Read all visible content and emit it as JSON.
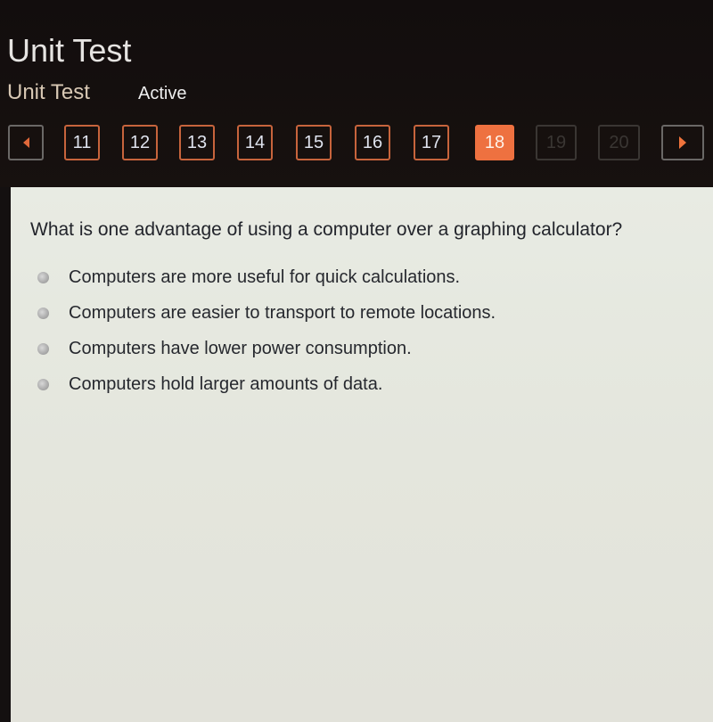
{
  "header": {
    "title": "Unit Test",
    "subtitle": "Unit Test",
    "status": "Active"
  },
  "pager": {
    "prev_icon": "triangle-left-icon",
    "next_icon": "triangle-right-icon",
    "pages": [
      "11",
      "12",
      "13",
      "14",
      "15",
      "16",
      "17",
      "18",
      "19",
      "20"
    ],
    "current": "18",
    "disabled": [
      "19",
      "20"
    ],
    "accent_color": "#ee7140"
  },
  "question": {
    "text": "What is one advantage of using a computer over a graphing calculator?",
    "options": [
      "Computers are more useful for quick calculations.",
      "Computers are easier to transport to remote locations.",
      "Computers have lower power consumption.",
      "Computers hold larger amounts of data."
    ]
  }
}
